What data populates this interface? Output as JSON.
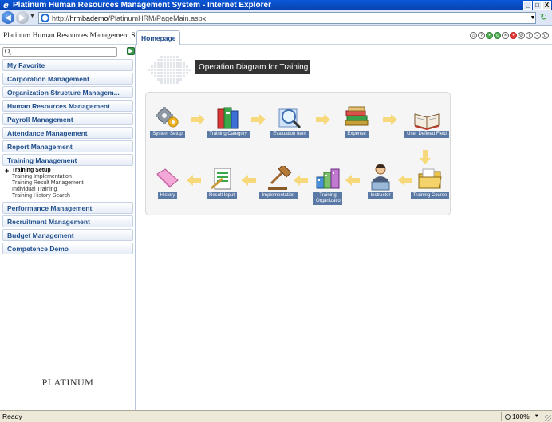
{
  "window": {
    "title": "Platinum Human Resources Management System - Internet Explorer",
    "minimize": "_",
    "maximize": "□",
    "close": "X"
  },
  "browser": {
    "url_prefix": "http://",
    "url_host": "hrmbademo",
    "url_path": "/PlatinumHRM/PageMain.aspx"
  },
  "app": {
    "title": "Platinum Human Resources Management System",
    "tab": "Homepage",
    "brand": "PLATINUM"
  },
  "sidebar": {
    "search": {
      "value": "",
      "placeholder": ""
    },
    "menu_top": [
      "My Favorite",
      "Corporation Management",
      "Organization Structure Managem...",
      "Human Resources Management",
      "Payroll Management",
      "Attendance Management",
      "Report Management",
      "Training Management"
    ],
    "training_sub": [
      "Training Setup",
      "Training Implementation",
      "Training Result Management",
      "Individual Training",
      "Training History Search"
    ],
    "menu_bottom": [
      "Performance Management",
      "Recruitment Management",
      "Budget Management",
      "Competence Demo"
    ]
  },
  "main": {
    "banner": "Operation Diagram for Training",
    "row1": [
      {
        "label": "System Setup",
        "icon": "gears-icon"
      },
      {
        "label": "Training Category",
        "icon": "books-icon"
      },
      {
        "label": "Evaluation Item",
        "icon": "magnifier-icon"
      },
      {
        "label": "Expense",
        "icon": "book-stack-icon"
      },
      {
        "label": "User Defined Field",
        "icon": "open-book-icon"
      }
    ],
    "row2": [
      {
        "label": "History",
        "icon": "pink-folder-icon"
      },
      {
        "label": "Result Input",
        "icon": "clipboard-icon"
      },
      {
        "label": "Implementation",
        "icon": "gavel-icon"
      },
      {
        "label": "Training Organization",
        "icon": "building-blocks-icon"
      },
      {
        "label": "Instructor",
        "icon": "instructor-icon"
      },
      {
        "label": "Training Course",
        "icon": "folder-icon"
      }
    ]
  },
  "status": {
    "text": "Ready",
    "zoom": "100%"
  }
}
